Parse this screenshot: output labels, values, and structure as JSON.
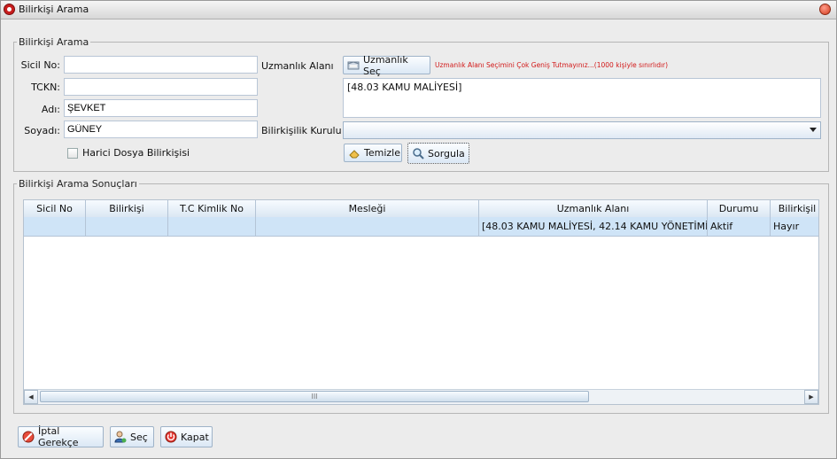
{
  "window": {
    "title": "Bilirkişi Arama"
  },
  "search": {
    "legend": "Bilirkişi Arama",
    "sicil_label": "Sicil No:",
    "sicil_value": "",
    "tckn_label": "TCKN:",
    "tckn_value": "",
    "adi_label": "Adı:",
    "adi_value": "ŞEVKET",
    "soyadi_label": "Soyadı:",
    "soyadi_value": "GÜNEY",
    "uzmanlik_label": "Uzmanlık Alanı",
    "uzmanlik_sec_label": "Uzmanlık Seç",
    "uzmanlik_hint": "Uzmanlık Alanı Seçimini Çok Geniş Tutmayınız...(1000 kişiyle sınırlıdır)",
    "uzmanlik_value": "[48.03 KAMU MALİYESİ]",
    "kurul_label": "Bilirkişilik Kurulu",
    "kurul_value": "",
    "harici_label": "Harici Dosya Bilirkişisi",
    "temizle_label": "Temizle",
    "sorgula_label": "Sorgula"
  },
  "results": {
    "legend": "Bilirkişi Arama Sonuçları",
    "columns": [
      "Sicil No",
      "Bilirkişi",
      "T.C Kimlik No",
      "Mesleği",
      "Uzmanlık Alanı",
      "Durumu",
      "Bilirkişil"
    ],
    "rows": [
      {
        "sicil": "",
        "bilirkisi": "",
        "tckn": "",
        "meslek": "",
        "uzmanlik": "[48.03 KAMU MALİYESİ, 42.14 KAMU YÖNETİMİ]",
        "durumu": "Aktif",
        "bilirkisilik": "Hayır"
      }
    ],
    "scroll_grip": "III"
  },
  "footer": {
    "iptal_label": "İptal Gerekçe",
    "sec_label": "Seç",
    "kapat_label": "Kapat"
  }
}
